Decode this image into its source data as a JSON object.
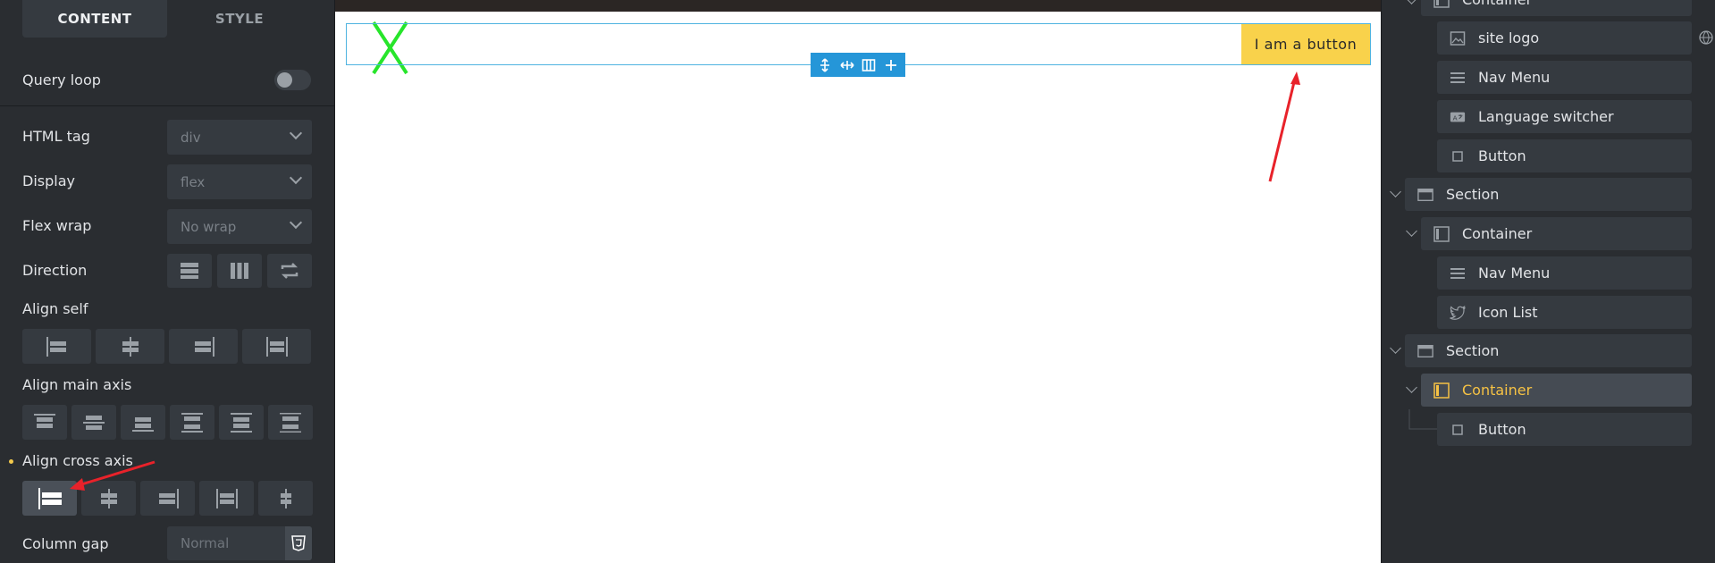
{
  "left_panel": {
    "tabs": [
      {
        "label": "CONTENT",
        "active": true
      },
      {
        "label": "STYLE",
        "active": false
      }
    ],
    "query_loop": {
      "label": "Query loop",
      "enabled": false
    },
    "html_tag": {
      "label": "HTML tag",
      "value": "div"
    },
    "display": {
      "label": "Display",
      "value": "flex"
    },
    "flex_wrap": {
      "label": "Flex wrap",
      "value": "No wrap"
    },
    "direction": {
      "label": "Direction",
      "options": [
        "row-icon",
        "column-icon",
        "reverse-icon"
      ]
    },
    "align_self": {
      "label": "Align self"
    },
    "align_main_axis": {
      "label": "Align main axis"
    },
    "align_cross_axis": {
      "label": "Align cross axis",
      "selected": "start",
      "modified_marker_color": "#f2c94c"
    },
    "column_gap": {
      "label": "Column gap",
      "placeholder": "Normal"
    }
  },
  "canvas": {
    "button_label": "I am a button",
    "button_color": "#f9d24b",
    "outline_color": "#4fb3e0",
    "toolbar_color": "#2596d8",
    "annotation_color": "#e8222a",
    "x_mark_color": "#27e52b"
  },
  "navigator": {
    "items": [
      {
        "label": "Container",
        "icon": "container-icon",
        "selected": false
      },
      {
        "label": "site logo",
        "icon": "image-icon",
        "selected": false
      },
      {
        "label": "Nav Menu",
        "icon": "menu-icon",
        "selected": false
      },
      {
        "label": "Language switcher",
        "icon": "language-icon",
        "selected": false
      },
      {
        "label": "Button",
        "icon": "square-icon",
        "selected": false
      },
      {
        "label": "Section",
        "icon": "section-icon",
        "selected": false
      },
      {
        "label": "Container",
        "icon": "container-icon",
        "selected": false
      },
      {
        "label": "Nav Menu",
        "icon": "menu-icon",
        "selected": false
      },
      {
        "label": "Icon List",
        "icon": "twitter-icon",
        "selected": false
      },
      {
        "label": "Section",
        "icon": "section-icon",
        "selected": false
      },
      {
        "label": "Container",
        "icon": "container-icon",
        "selected": true
      },
      {
        "label": "Button",
        "icon": "square-icon",
        "selected": false
      }
    ]
  }
}
